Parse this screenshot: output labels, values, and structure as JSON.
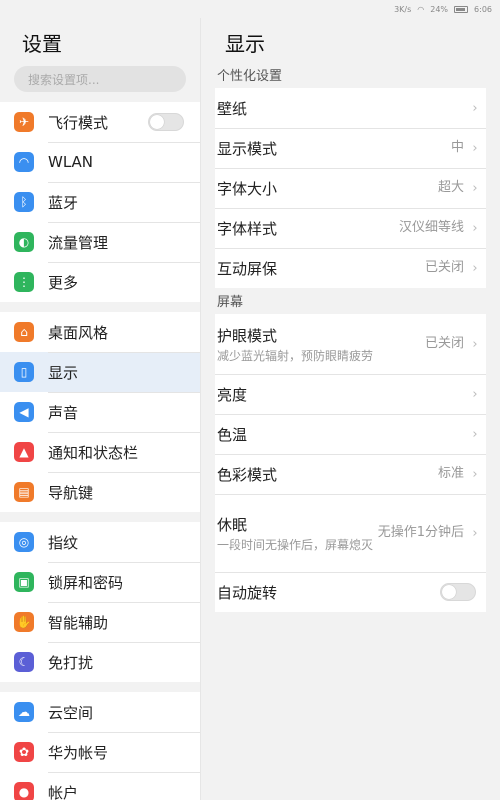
{
  "status": {
    "carrier": "3K/s",
    "battery_text": "24%",
    "time": "6:06"
  },
  "left": {
    "title": "设置",
    "search_placeholder": "搜索设置项...",
    "groups": [
      [
        {
          "label": "飞行模式",
          "icon": "airplane-icon",
          "color": "#f07a2a",
          "toggle": true
        },
        {
          "label": "WLAN",
          "icon": "wifi-icon",
          "color": "#3a8ff0"
        },
        {
          "label": "蓝牙",
          "icon": "bluetooth-icon",
          "color": "#3a8ff0"
        },
        {
          "label": "流量管理",
          "icon": "data-usage-icon",
          "color": "#2fb55d"
        },
        {
          "label": "更多",
          "icon": "more-icon",
          "color": "#2fb55d"
        }
      ],
      [
        {
          "label": "桌面风格",
          "icon": "home-icon",
          "color": "#f07a2a"
        },
        {
          "label": "显示",
          "icon": "display-icon",
          "color": "#3a8ff0",
          "active": true
        },
        {
          "label": "声音",
          "icon": "sound-icon",
          "color": "#3a8ff0"
        },
        {
          "label": "通知和状态栏",
          "icon": "notification-icon",
          "color": "#f04545"
        },
        {
          "label": "导航键",
          "icon": "navigation-icon",
          "color": "#f07a2a"
        }
      ],
      [
        {
          "label": "指纹",
          "icon": "fingerprint-icon",
          "color": "#3a8ff0"
        },
        {
          "label": "锁屏和密码",
          "icon": "lock-icon",
          "color": "#2fb55d"
        },
        {
          "label": "智能辅助",
          "icon": "hand-icon",
          "color": "#f07a2a"
        },
        {
          "label": "免打扰",
          "icon": "moon-icon",
          "color": "#5b5fd6"
        }
      ],
      [
        {
          "label": "云空间",
          "icon": "cloud-icon",
          "color": "#3a8ff0"
        },
        {
          "label": "华为帐号",
          "icon": "huawei-icon",
          "color": "#f04545"
        },
        {
          "label": "帐户",
          "icon": "account-icon",
          "color": "#f04545"
        }
      ]
    ]
  },
  "right": {
    "title": "显示",
    "sections": [
      {
        "header": "个性化设置",
        "items": [
          {
            "label": "壁纸",
            "value": ""
          },
          {
            "label": "显示模式",
            "value": "中"
          },
          {
            "label": "字体大小",
            "value": "超大"
          },
          {
            "label": "字体样式",
            "value": "汉仪细等线"
          },
          {
            "label": "互动屏保",
            "value": "已关闭"
          }
        ]
      },
      {
        "header": "屏幕",
        "items": [
          {
            "label": "护眼模式",
            "sub": "减少蓝光辐射，预防眼睛疲劳",
            "value": "已关闭",
            "tall": "tall"
          },
          {
            "label": "亮度",
            "value": ""
          },
          {
            "label": "色温",
            "value": ""
          },
          {
            "label": "色彩模式",
            "value": "标准"
          },
          {
            "label": "休眠",
            "sub": "一段时间无操作后，屏幕熄灭",
            "value": "无操作1分钟后",
            "tall": "tall2"
          },
          {
            "label": "自动旋转",
            "toggle": true
          }
        ]
      }
    ]
  }
}
